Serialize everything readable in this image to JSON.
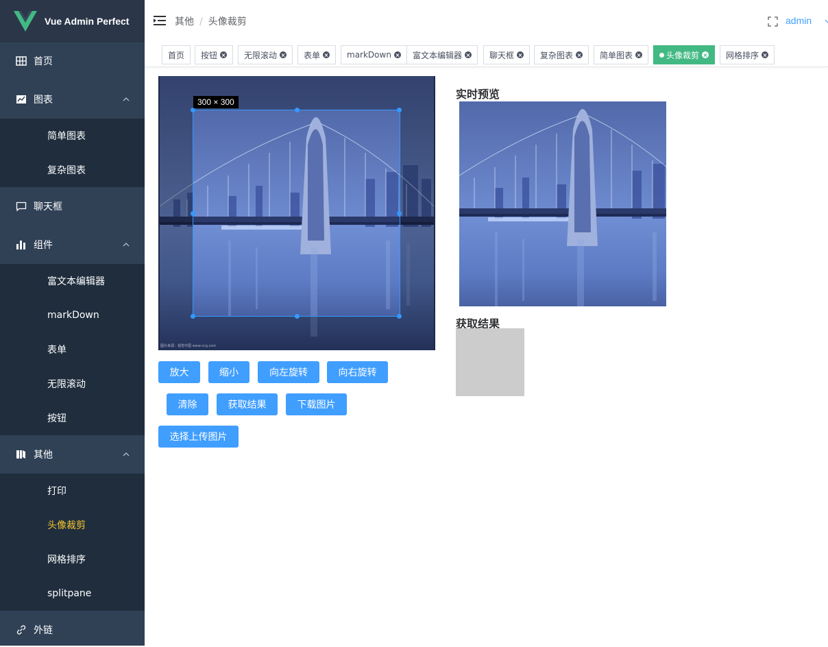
{
  "app": {
    "title": "Vue Admin Perfect"
  },
  "sidebar": {
    "items": [
      {
        "label": "首页",
        "icon": "grid-icon"
      },
      {
        "label": "图表",
        "icon": "chart-icon",
        "expanded": true
      },
      {
        "label": "简单图表"
      },
      {
        "label": "复杂图表"
      },
      {
        "label": "聊天框",
        "icon": "chat-icon"
      },
      {
        "label": "组件",
        "icon": "bar-icon",
        "expanded": true
      },
      {
        "label": "富文本编辑器"
      },
      {
        "label": "markDown"
      },
      {
        "label": "表单"
      },
      {
        "label": "无限滚动"
      },
      {
        "label": "按钮"
      },
      {
        "label": "其他",
        "icon": "book-icon",
        "expanded": true
      },
      {
        "label": "打印"
      },
      {
        "label": "头像裁剪",
        "active": true
      },
      {
        "label": "网格排序"
      },
      {
        "label": "splitpane"
      },
      {
        "label": "外链",
        "icon": "link-icon"
      }
    ]
  },
  "header": {
    "breadcrumb": [
      "其他",
      "头像裁剪"
    ],
    "separator": "/",
    "user": "admin"
  },
  "tags": [
    {
      "label": "首页",
      "closable": false
    },
    {
      "label": "按钮",
      "closable": true
    },
    {
      "label": "无限滚动",
      "closable": true
    },
    {
      "label": "表单",
      "closable": true
    },
    {
      "label": "markDown",
      "closable": true
    },
    {
      "label": "富文本编辑器",
      "closable": true
    },
    {
      "label": "聊天框",
      "closable": true
    },
    {
      "label": "复杂图表",
      "closable": true
    },
    {
      "label": "简单图表",
      "closable": true
    },
    {
      "label": "头像裁剪",
      "closable": true,
      "active": true
    },
    {
      "label": "网格排序",
      "closable": true
    }
  ],
  "cropper": {
    "size_label": "300 × 300",
    "credit": "图片来源：视觉中国 www.vcg.com"
  },
  "buttons": {
    "zoom_in": "放大",
    "zoom_out": "缩小",
    "rotate_left": "向左旋转",
    "rotate_right": "向右旋转",
    "clear": "清除",
    "get_result": "获取结果",
    "download": "下载图片",
    "upload": "选择上传图片"
  },
  "preview": {
    "title": "实时预览"
  },
  "result": {
    "title": "获取结果"
  },
  "colors": {
    "sidebar_bg": "#304156",
    "active_menu": "#f4c430",
    "primary": "#409eff",
    "active_tag": "#42b983"
  }
}
